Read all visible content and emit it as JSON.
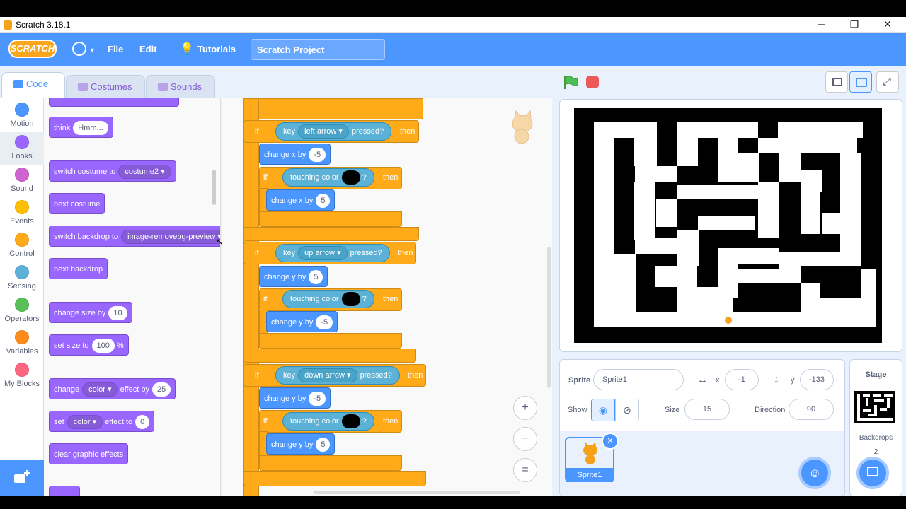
{
  "window": {
    "title": "Scratch 3.18.1",
    "minimize": "─",
    "maximize": "❐",
    "close": "✕"
  },
  "menu": {
    "logo": "SCRATCH",
    "file": "File",
    "edit": "Edit",
    "tutorials": "Tutorials",
    "project_title": "Scratch Project"
  },
  "tabs": [
    {
      "label": "Code"
    },
    {
      "label": "Costumes"
    },
    {
      "label": "Sounds"
    }
  ],
  "categories": [
    {
      "label": "Motion",
      "color": "#4c97ff"
    },
    {
      "label": "Looks",
      "color": "#9966ff"
    },
    {
      "label": "Sound",
      "color": "#cf63cf"
    },
    {
      "label": "Events",
      "color": "#ffbf00"
    },
    {
      "label": "Control",
      "color": "#ffab19"
    },
    {
      "label": "Sensing",
      "color": "#5cb1d6"
    },
    {
      "label": "Operators",
      "color": "#59c059"
    },
    {
      "label": "Variables",
      "color": "#ff8c1a"
    },
    {
      "label": "My Blocks",
      "color": "#ff6680"
    }
  ],
  "palette": {
    "think": "think",
    "think_val": "Hmm...",
    "switch_costume": "switch costume to",
    "costume_val": "costume2",
    "next_costume": "next costume",
    "switch_backdrop": "switch backdrop to",
    "backdrop_val": "image-removebg-preview",
    "next_backdrop": "next backdrop",
    "change_size": "change size by",
    "change_size_val": "10",
    "set_size": "set size to",
    "set_size_val": "100",
    "set_size_unit": "%",
    "change_effect": "change",
    "change_effect_dd": "color",
    "change_effect_by": "effect by",
    "change_effect_val": "25",
    "set_effect": "set",
    "set_effect_dd": "color",
    "set_effect_to": "effect to",
    "set_effect_val": "0",
    "clear_effects": "clear graphic effects"
  },
  "script": {
    "if": "if",
    "then": "then",
    "key": "key",
    "pressed": "pressed?",
    "touching_color": "touching color",
    "q": "?",
    "left_arrow": "left arrow",
    "up_arrow": "up arrow",
    "down_arrow": "down arrow",
    "change_x_by": "change x by",
    "change_y_by": "change y by",
    "v_m5": "-5",
    "v_5": "5"
  },
  "zoom": {
    "in": "+",
    "out": "−",
    "reset": "="
  },
  "sprite_info": {
    "sprite_label": "Sprite",
    "sprite_name": "Sprite1",
    "x_label": "x",
    "x_val": "-1",
    "y_label": "y",
    "y_val": "-133",
    "show_label": "Show",
    "size_label": "Size",
    "size_val": "15",
    "direction_label": "Direction",
    "direction_val": "90"
  },
  "sprite_tile": {
    "name": "Sprite1"
  },
  "stage_panel": {
    "title": "Stage",
    "backdrops_label": "Backdrops",
    "backdrops_count": "2"
  }
}
